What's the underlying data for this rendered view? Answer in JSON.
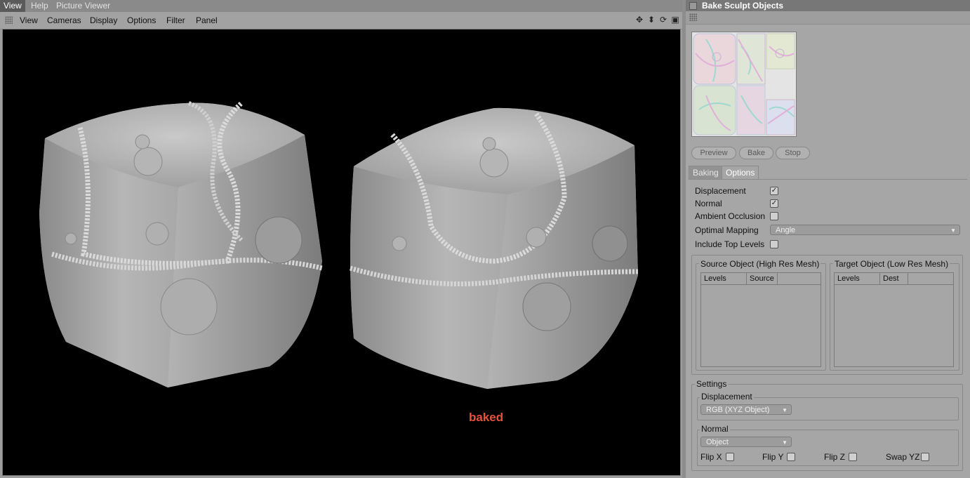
{
  "top_tabs": [
    "View",
    "Help",
    "Picture Viewer"
  ],
  "viewport_menu": [
    "View",
    "Cameras",
    "Display",
    "Options",
    "Filter",
    "Panel"
  ],
  "viewport": {
    "label": "baked",
    "label_color": "#e8523c"
  },
  "panel": {
    "title": "Bake Sculpt Objects",
    "buttons": {
      "preview": "Preview",
      "bake": "Bake",
      "stop": "Stop"
    },
    "tabs": [
      "Baking",
      "Options"
    ],
    "options": {
      "displacement": "Displacement",
      "normal": "Normal",
      "ambient_occlusion": "Ambient Occlusion",
      "optimal_mapping": "Optimal Mapping",
      "optimal_mapping_value": "Angle",
      "include_top_levels": "Include Top Levels",
      "checks": {
        "displacement": "✓",
        "normal": "✓"
      }
    },
    "source": {
      "title": "Source Object (High Res Mesh)",
      "col1": "Levels",
      "col2": "Source"
    },
    "target": {
      "title": "Target Object (Low Res Mesh)",
      "col1": "Levels",
      "col2": "Dest"
    },
    "settings": {
      "title": "Settings",
      "displacement_title": "Displacement",
      "displacement_value": "RGB (XYZ Object)",
      "normal_title": "Normal",
      "normal_value": "Object",
      "flip_x": "Flip X",
      "flip_y": "Flip Y",
      "flip_z": "Flip Z",
      "swap_yz": "Swap YZ"
    }
  }
}
